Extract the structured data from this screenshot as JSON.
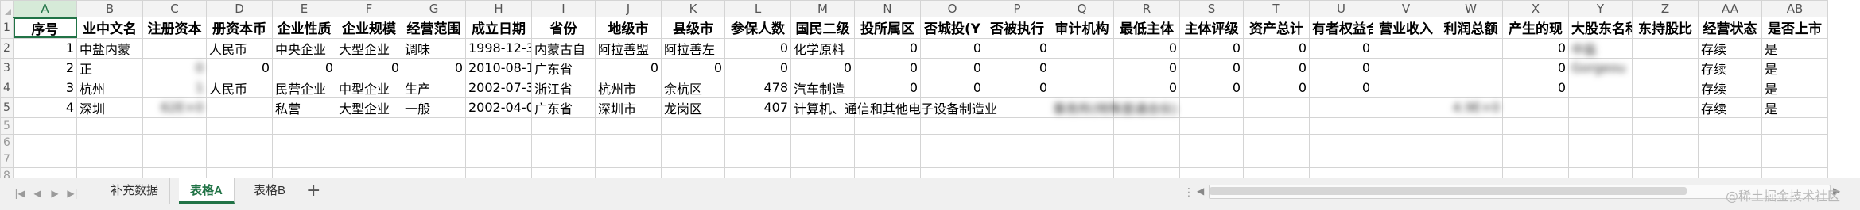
{
  "columns": [
    "A",
    "B",
    "C",
    "D",
    "E",
    "F",
    "G",
    "H",
    "I",
    "J",
    "K",
    "L",
    "M",
    "N",
    "O",
    "P",
    "Q",
    "R",
    "S",
    "T",
    "U",
    "V",
    "W",
    "X",
    "Y",
    "Z",
    "AA",
    "AB"
  ],
  "header_row": [
    "序号",
    "业中文名",
    "注册资本",
    "册资本币",
    "企业性质",
    "企业规模",
    "经营范围",
    "成立日期",
    "省份",
    "地级市",
    "县级市",
    "参保人数",
    "国民二级",
    "投所属区",
    "否城投(Y",
    "否被执行",
    "审计机构",
    "最低主体",
    "主体评级",
    "资产总计",
    "有者权益合",
    "营业收入",
    "利润总额",
    "产生的现",
    "大股东名称",
    "东持股比",
    "经营状态",
    "是否上市"
  ],
  "rows": [
    {
      "num": "1",
      "cells": [
        "1",
        "中盐内蒙",
        "",
        "人民币",
        "中央企业",
        "大型企业",
        "调味",
        "1998-12-3",
        "内蒙古自",
        "阿拉善盟",
        "阿拉善左",
        "0",
        "化学原料",
        "0",
        "0",
        "0",
        "",
        "0",
        "0",
        "0",
        "0",
        "",
        "",
        "0",
        "中盐",
        "",
        "存续",
        "是"
      ]
    },
    {
      "num": "2",
      "cells": [
        "2",
        "正",
        "0",
        "0",
        "0",
        "0",
        "0",
        "2010-08-1",
        "广东省",
        "0",
        "0",
        "0",
        "0",
        "0",
        "0",
        "0",
        "",
        "0",
        "0",
        "0",
        "0",
        "",
        "",
        "0",
        "Gorgeou",
        "",
        "存续",
        "是"
      ]
    },
    {
      "num": "3",
      "cells": [
        "3",
        "杭州",
        "1",
        "人民币",
        "民营企业",
        "中型企业",
        "生产",
        "2002-07-3",
        "浙江省",
        "杭州市",
        "余杭区",
        "478",
        "汽车制造",
        "0",
        "0",
        "0",
        "",
        "0",
        "0",
        "0",
        "0",
        "",
        "",
        "0",
        "",
        "",
        "存续",
        "是"
      ]
    },
    {
      "num": "4",
      "cells": [
        "4",
        "深圳",
        "62E+0",
        "",
        "私营",
        "大型企业",
        "一般",
        "2002-04-0",
        "广东省",
        "深圳市",
        "龙岗区",
        "407",
        "计算机、通信和其他电子设备制造业",
        "",
        "",
        "",
        "事务所(特殊普通合伙)",
        "",
        "",
        "",
        "",
        "",
        "4.9E+0",
        "",
        "",
        "",
        "存续",
        "是"
      ]
    }
  ],
  "empty_rows": [
    "5",
    "6",
    "7",
    "8",
    "9",
    "10"
  ],
  "sheet_tabs": [
    "补充数据",
    "表格A",
    "表格B"
  ],
  "active_tab": "表格A",
  "add_tab_label": "+",
  "watermark": "@稀土掘金技术社区",
  "colors": {
    "accent": "#217346",
    "grid": "#d4d4d4",
    "header_bg": "#f3f3f3"
  }
}
